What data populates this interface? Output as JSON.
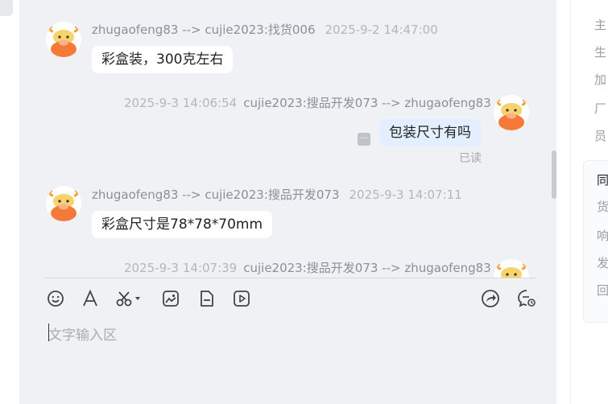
{
  "messages": [
    {
      "direction": "incoming",
      "sender": "zhugaofeng83 --> cujie2023:找货006",
      "time": "2025-9-2 14:47:00",
      "text": "彩盒装，300克左右"
    },
    {
      "direction": "outgoing",
      "sender": "cujie2023:搜品开发073 --> zhugaofeng83",
      "time": "2025-9-3 14:06:54",
      "text": "包装尺寸有吗",
      "status": "已读"
    },
    {
      "direction": "incoming",
      "sender": "zhugaofeng83 --> cujie2023:搜品开发073",
      "time": "2025-9-3 14:07:11",
      "text": "彩盒尺寸是78*78*70mm"
    },
    {
      "direction": "outgoing",
      "sender": "cujie2023:搜品开发073 --> zhugaofeng83",
      "time": "2025-9-3 14:07:39"
    }
  ],
  "composer": {
    "placeholder": "文字输入区",
    "tools": [
      "emoji-icon",
      "font-icon",
      "scissors-icon",
      "image-icon",
      "file-icon",
      "video-icon",
      "share-icon",
      "chat-settings-icon"
    ]
  },
  "side_panel": {
    "labels": [
      "主",
      "生",
      "加",
      "厂",
      "员"
    ],
    "card_title": "同",
    "card_items": [
      "货",
      "响",
      "发",
      "回"
    ]
  },
  "colors": {
    "accent": "#e3eefe",
    "panel_bg": "#f0f1f5",
    "avatar_orange": "#f57a3a"
  }
}
